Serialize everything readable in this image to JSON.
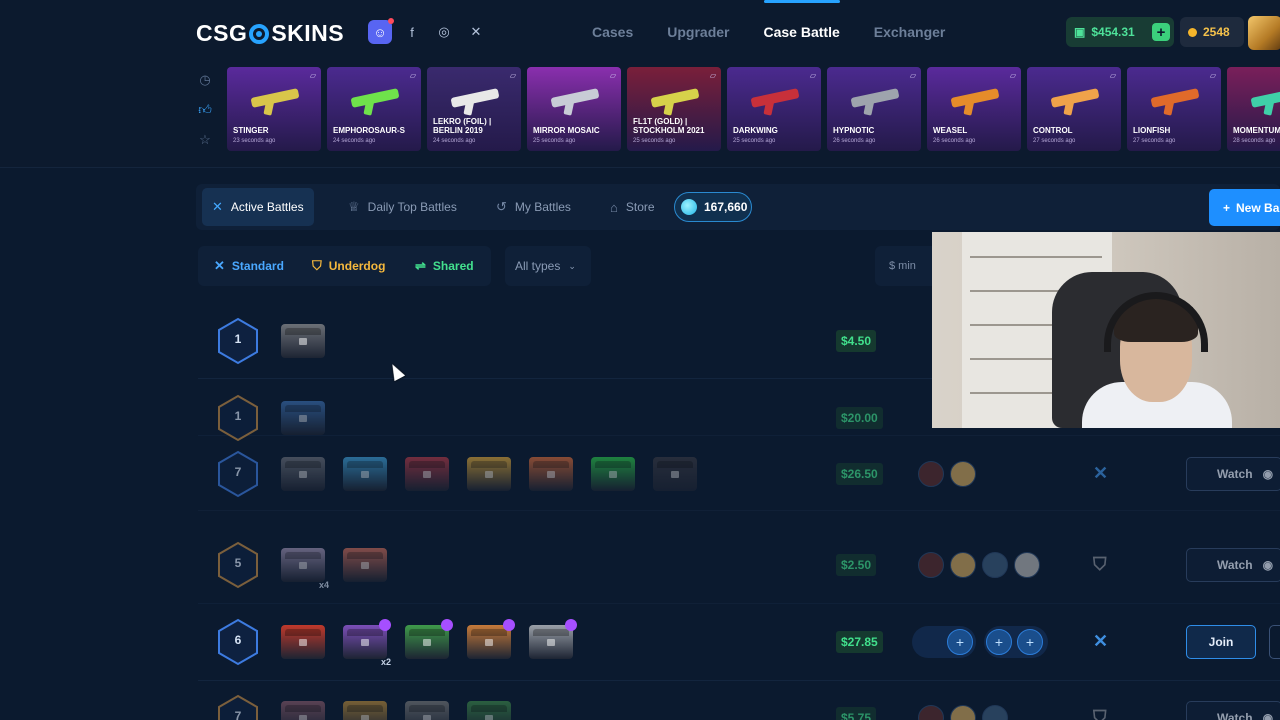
{
  "header": {
    "logo_left": "CSG",
    "logo_right": "SKINS",
    "nav": [
      "Cases",
      "Upgrader",
      "Case Battle",
      "Exchanger"
    ],
    "balance": "$454.31",
    "coins": "2548"
  },
  "live_drops": [
    {
      "name": "STINGER",
      "time": "23 seconds ago",
      "bg": "#5a2a9c",
      "gun": "#d8c64a"
    },
    {
      "name": "EMPHOROSAUR-S",
      "time": "24 seconds ago",
      "bg": "#4b2a8f",
      "gun": "#6fe24b"
    },
    {
      "name": "LEKRO (FOIL) | BERLIN 2019",
      "time": "24 seconds ago",
      "bg": "#3a2a6e",
      "gun": "#e8e8e8"
    },
    {
      "name": "MIRROR MOSAIC",
      "time": "25 seconds ago",
      "bg": "#8a2fae",
      "gun": "#c8ccd6"
    },
    {
      "name": "FL1T (GOLD) | STOCKHOLM 2021",
      "time": "25 seconds ago",
      "bg": "#7a1f3a",
      "gun": "#d6d24a"
    },
    {
      "name": "DARKWING",
      "time": "25 seconds ago",
      "bg": "#4b2a8f",
      "gun": "#c8303a"
    },
    {
      "name": "HYPNOTIC",
      "time": "26 seconds ago",
      "bg": "#4b2a8f",
      "gun": "#9ea4ad"
    },
    {
      "name": "WEASEL",
      "time": "26 seconds ago",
      "bg": "#5a2a9c",
      "gun": "#e58c2a"
    },
    {
      "name": "CONTROL",
      "time": "27 seconds ago",
      "bg": "#4b2a8f",
      "gun": "#f0a24a"
    },
    {
      "name": "LIONFISH",
      "time": "27 seconds ago",
      "bg": "#4b2a8f",
      "gun": "#e06a2a"
    },
    {
      "name": "MOMENTUM",
      "time": "28 seconds ago",
      "bg": "#7a1f5a",
      "gun": "#3fd0a8"
    }
  ],
  "tabs": {
    "active_battles": "Active Battles",
    "daily_top": "Daily Top Battles",
    "my_battles": "My Battles",
    "store": "Store",
    "gems": "167,660",
    "new_battle": "New Ba"
  },
  "filters": {
    "standard": "Standard",
    "underdog": "Underdog",
    "shared": "Shared",
    "all_types": "All types",
    "min": "$ min"
  },
  "battles": [
    {
      "rounds": "1",
      "price": "$4.50",
      "hex_color": "#3d7be0"
    },
    {
      "rounds": "1",
      "price": "$20.00",
      "hex_color": "#c08a45"
    },
    {
      "rounds": "7",
      "price": "$26.50",
      "hex_color": "#3d7be0",
      "action": "Watch"
    },
    {
      "rounds": "5",
      "price": "$2.50",
      "hex_color": "#c08a45",
      "action": "Watch",
      "case_multiplier": "x4"
    },
    {
      "rounds": "6",
      "price": "$27.85",
      "hex_color": "#3d7be0",
      "action": "Join",
      "case_multiplier": "x2"
    },
    {
      "rounds": "7",
      "price": "$5.75",
      "hex_color": "#c08a45",
      "action": "Watch"
    }
  ],
  "colors": {
    "accent": "#27a3ff",
    "standard": "#4aa8ff",
    "underdog": "#f5b83d",
    "shared": "#43e08e",
    "price_green": "#41e08c"
  }
}
